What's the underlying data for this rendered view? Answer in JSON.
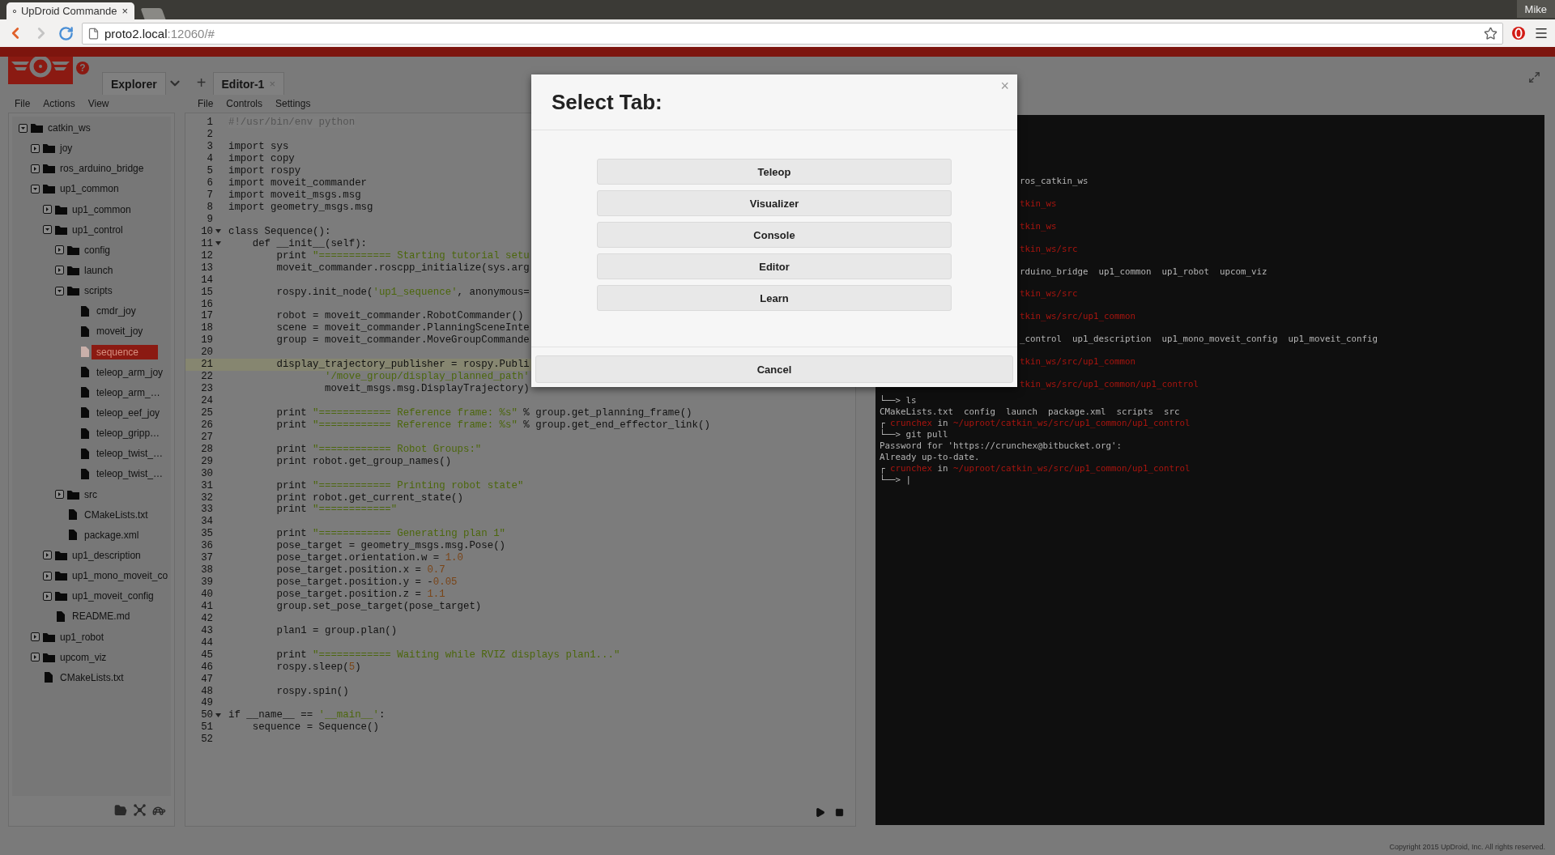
{
  "browser": {
    "tab_title": "UpDroid Commande",
    "tab_close": "×",
    "url_host": "proto2.local",
    "url_rest": ":12060/#",
    "user": "Mike"
  },
  "app": {
    "help": "?",
    "add_tab": "+"
  },
  "explorer": {
    "tab": "Explorer",
    "menu": [
      "File",
      "Actions",
      "View"
    ],
    "tree": [
      {
        "name": "catkin_ws",
        "kind": "folder",
        "expanded": true,
        "selected": false,
        "children": [
          {
            "name": "joy",
            "kind": "folder",
            "expanded": false,
            "selected": false
          },
          {
            "name": "ros_arduino_bridge",
            "kind": "folder",
            "expanded": false,
            "selected": false
          },
          {
            "name": "up1_common",
            "kind": "folder",
            "expanded": true,
            "selected": false,
            "children": [
              {
                "name": "up1_common",
                "kind": "folder",
                "expanded": false,
                "selected": false
              },
              {
                "name": "up1_control",
                "kind": "folder",
                "expanded": true,
                "selected": false,
                "children": [
                  {
                    "name": "config",
                    "kind": "folder",
                    "expanded": false,
                    "selected": false
                  },
                  {
                    "name": "launch",
                    "kind": "folder",
                    "expanded": false,
                    "selected": false
                  },
                  {
                    "name": "scripts",
                    "kind": "folder",
                    "expanded": true,
                    "selected": false,
                    "children": [
                      {
                        "name": "cmdr_joy",
                        "kind": "file",
                        "selected": false
                      },
                      {
                        "name": "moveit_joy",
                        "kind": "file",
                        "selected": false
                      },
                      {
                        "name": "sequence",
                        "kind": "file",
                        "selected": true
                      },
                      {
                        "name": "teleop_arm_joy",
                        "kind": "file",
                        "selected": false
                      },
                      {
                        "name": "teleop_arm_…",
                        "kind": "file",
                        "selected": false
                      },
                      {
                        "name": "teleop_eef_joy",
                        "kind": "file",
                        "selected": false
                      },
                      {
                        "name": "teleop_gripp…",
                        "kind": "file",
                        "selected": false
                      },
                      {
                        "name": "teleop_twist_…",
                        "kind": "file",
                        "selected": false
                      },
                      {
                        "name": "teleop_twist_…",
                        "kind": "file",
                        "selected": false
                      }
                    ]
                  },
                  {
                    "name": "src",
                    "kind": "folder",
                    "expanded": false,
                    "selected": false
                  },
                  {
                    "name": "CMakeLists.txt",
                    "kind": "file",
                    "selected": false
                  },
                  {
                    "name": "package.xml",
                    "kind": "file",
                    "selected": false
                  }
                ]
              },
              {
                "name": "up1_description",
                "kind": "folder",
                "expanded": false,
                "selected": false
              },
              {
                "name": "up1_mono_moveit_co",
                "kind": "folder",
                "expanded": false,
                "selected": false
              },
              {
                "name": "up1_moveit_config",
                "kind": "folder",
                "expanded": false,
                "selected": false
              },
              {
                "name": "README.md",
                "kind": "file",
                "selected": false
              }
            ]
          },
          {
            "name": "up1_robot",
            "kind": "folder",
            "expanded": false,
            "selected": false
          },
          {
            "name": "upcom_viz",
            "kind": "folder",
            "expanded": false,
            "selected": false
          },
          {
            "name": "CMakeLists.txt",
            "kind": "file",
            "selected": false
          }
        ]
      }
    ]
  },
  "editor": {
    "tab": "Editor-1",
    "tab_close": "×",
    "menu": [
      "File",
      "Controls",
      "Settings"
    ],
    "lines": [
      {
        "n": "1",
        "fold": false,
        "current": false,
        "code": [
          {
            "t": "#!/usr/bin/env python",
            "kind": "comment"
          }
        ]
      },
      {
        "n": "2",
        "fold": false,
        "current": false
      },
      {
        "n": "3",
        "fold": false,
        "current": false,
        "code": [
          {
            "t": "import sys",
            "kind": "plain"
          }
        ]
      },
      {
        "n": "4",
        "fold": false,
        "current": false,
        "code": [
          {
            "t": "import copy",
            "kind": "plain"
          }
        ]
      },
      {
        "n": "5",
        "fold": false,
        "current": false,
        "code": [
          {
            "t": "import rospy",
            "kind": "plain"
          }
        ]
      },
      {
        "n": "6",
        "fold": false,
        "current": false,
        "code": [
          {
            "t": "import moveit_commander",
            "kind": "plain"
          }
        ]
      },
      {
        "n": "7",
        "fold": false,
        "current": false,
        "code": [
          {
            "t": "import moveit_msgs.msg",
            "kind": "plain"
          }
        ]
      },
      {
        "n": "8",
        "fold": false,
        "current": false,
        "code": [
          {
            "t": "import geometry_msgs.msg",
            "kind": "plain"
          }
        ]
      },
      {
        "n": "9",
        "fold": false,
        "current": false
      },
      {
        "n": "10",
        "fold": true,
        "current": false,
        "code": [
          {
            "t": "class Sequence():",
            "kind": "plain"
          }
        ]
      },
      {
        "n": "11",
        "fold": true,
        "current": false,
        "code": [
          {
            "t": "    def __init__(self):",
            "kind": "plain"
          }
        ]
      },
      {
        "n": "12",
        "fold": false,
        "current": false,
        "code": [
          {
            "t": "        print ",
            "kind": "plain"
          },
          {
            "t": "\"============ Starting tutorial setu",
            "kind": "string"
          }
        ]
      },
      {
        "n": "13",
        "fold": false,
        "current": false,
        "code": [
          {
            "t": "        moveit_commander.roscpp_initialize(sys.arg",
            "kind": "plain"
          }
        ]
      },
      {
        "n": "14",
        "fold": false,
        "current": false
      },
      {
        "n": "15",
        "fold": false,
        "current": false,
        "code": [
          {
            "t": "        rospy.init_node(",
            "kind": "plain"
          },
          {
            "t": "'up1_sequence'",
            "kind": "string"
          },
          {
            "t": ", anonymous=",
            "kind": "plain"
          }
        ]
      },
      {
        "n": "16",
        "fold": false,
        "current": false
      },
      {
        "n": "17",
        "fold": false,
        "current": false,
        "code": [
          {
            "t": "        robot = moveit_commander.RobotCommander()",
            "kind": "plain"
          }
        ]
      },
      {
        "n": "18",
        "fold": false,
        "current": false,
        "code": [
          {
            "t": "        scene = moveit_commander.PlanningSceneInte",
            "kind": "plain"
          }
        ]
      },
      {
        "n": "19",
        "fold": false,
        "current": false,
        "code": [
          {
            "t": "        group = moveit_commander.MoveGroupCommande",
            "kind": "plain"
          }
        ]
      },
      {
        "n": "20",
        "fold": false,
        "current": false
      },
      {
        "n": "21",
        "fold": false,
        "current": true,
        "code": [
          {
            "t": "        display_trajectory_publisher = rospy.Publi",
            "kind": "plain"
          }
        ]
      },
      {
        "n": "22",
        "fold": false,
        "current": false,
        "code": [
          {
            "t": "                '/move_group/display_planned_path'",
            "kind": "string"
          }
        ]
      },
      {
        "n": "23",
        "fold": false,
        "current": false,
        "code": [
          {
            "t": "                moveit_msgs.msg.DisplayTrajectory)",
            "kind": "plain"
          }
        ]
      },
      {
        "n": "24",
        "fold": false,
        "current": false
      },
      {
        "n": "25",
        "fold": false,
        "current": false,
        "code": [
          {
            "t": "        print ",
            "kind": "plain"
          },
          {
            "t": "\"============ Reference frame: %s\"",
            "kind": "string"
          },
          {
            "t": " % group.get_planning_frame()",
            "kind": "plain"
          }
        ]
      },
      {
        "n": "26",
        "fold": false,
        "current": false,
        "code": [
          {
            "t": "        print ",
            "kind": "plain"
          },
          {
            "t": "\"============ Reference frame: %s\"",
            "kind": "string"
          },
          {
            "t": " % group.get_end_effector_link()",
            "kind": "plain"
          }
        ]
      },
      {
        "n": "27",
        "fold": false,
        "current": false
      },
      {
        "n": "28",
        "fold": false,
        "current": false,
        "code": [
          {
            "t": "        print ",
            "kind": "plain"
          },
          {
            "t": "\"============ Robot Groups:\"",
            "kind": "string"
          }
        ]
      },
      {
        "n": "29",
        "fold": false,
        "current": false,
        "code": [
          {
            "t": "        print robot.get_group_names()",
            "kind": "plain"
          }
        ]
      },
      {
        "n": "30",
        "fold": false,
        "current": false
      },
      {
        "n": "31",
        "fold": false,
        "current": false,
        "code": [
          {
            "t": "        print ",
            "kind": "plain"
          },
          {
            "t": "\"============ Printing robot state\"",
            "kind": "string"
          }
        ]
      },
      {
        "n": "32",
        "fold": false,
        "current": false,
        "code": [
          {
            "t": "        print robot.get_current_state()",
            "kind": "plain"
          }
        ]
      },
      {
        "n": "33",
        "fold": false,
        "current": false,
        "code": [
          {
            "t": "        print ",
            "kind": "plain"
          },
          {
            "t": "\"============\"",
            "kind": "string"
          }
        ]
      },
      {
        "n": "34",
        "fold": false,
        "current": false
      },
      {
        "n": "35",
        "fold": false,
        "current": false,
        "code": [
          {
            "t": "        print ",
            "kind": "plain"
          },
          {
            "t": "\"============ Generating plan 1\"",
            "kind": "string"
          }
        ]
      },
      {
        "n": "36",
        "fold": false,
        "current": false,
        "code": [
          {
            "t": "        pose_target = geometry_msgs.msg.Pose()",
            "kind": "plain"
          }
        ]
      },
      {
        "n": "37",
        "fold": false,
        "current": false,
        "code": [
          {
            "t": "        pose_target.orientation.w = ",
            "kind": "plain"
          },
          {
            "t": "1.0",
            "kind": "number"
          }
        ]
      },
      {
        "n": "38",
        "fold": false,
        "current": false,
        "code": [
          {
            "t": "        pose_target.position.x = ",
            "kind": "plain"
          },
          {
            "t": "0.7",
            "kind": "number"
          }
        ]
      },
      {
        "n": "39",
        "fold": false,
        "current": false,
        "code": [
          {
            "t": "        pose_target.position.y = -",
            "kind": "plain"
          },
          {
            "t": "0.05",
            "kind": "number"
          }
        ]
      },
      {
        "n": "40",
        "fold": false,
        "current": false,
        "code": [
          {
            "t": "        pose_target.position.z = ",
            "kind": "plain"
          },
          {
            "t": "1.1",
            "kind": "number"
          }
        ]
      },
      {
        "n": "41",
        "fold": false,
        "current": false,
        "code": [
          {
            "t": "        group.set_pose_target(pose_target)",
            "kind": "plain"
          }
        ]
      },
      {
        "n": "42",
        "fold": false,
        "current": false
      },
      {
        "n": "43",
        "fold": false,
        "current": false,
        "code": [
          {
            "t": "        plan1 = group.plan()",
            "kind": "plain"
          }
        ]
      },
      {
        "n": "44",
        "fold": false,
        "current": false
      },
      {
        "n": "45",
        "fold": false,
        "current": false,
        "code": [
          {
            "t": "        print ",
            "kind": "plain"
          },
          {
            "t": "\"============ Waiting while RVIZ displays plan1...\"",
            "kind": "string"
          }
        ]
      },
      {
        "n": "46",
        "fold": false,
        "current": false,
        "code": [
          {
            "t": "        rospy.sleep(",
            "kind": "plain"
          },
          {
            "t": "5",
            "kind": "number"
          },
          {
            "t": ")",
            "kind": "plain"
          }
        ]
      },
      {
        "n": "47",
        "fold": false,
        "current": false
      },
      {
        "n": "48",
        "fold": false,
        "current": false,
        "code": [
          {
            "t": "        rospy.spin()",
            "kind": "plain"
          }
        ]
      },
      {
        "n": "49",
        "fold": false,
        "current": false
      },
      {
        "n": "50",
        "fold": true,
        "current": false,
        "code": [
          {
            "t": "if __name__ == ",
            "kind": "plain"
          },
          {
            "t": "'__main__'",
            "kind": "string"
          },
          {
            "t": ":",
            "kind": "plain"
          }
        ]
      },
      {
        "n": "51",
        "fold": false,
        "current": false,
        "code": [
          {
            "t": "    sequence = Sequence()",
            "kind": "plain"
          }
        ]
      },
      {
        "n": "52",
        "fold": false,
        "current": false
      }
    ]
  },
  "console": {
    "lines": [
      {
        "kind": "partial",
        "parts": [
          {
            "t": "ros_catkin_ws",
            "kind": "plain"
          }
        ]
      },
      {
        "kind": "partial",
        "parts": [
          {
            "t": "tkin_ws",
            "kind": "red"
          }
        ]
      },
      {
        "kind": "partial",
        "parts": [
          {
            "t": "tkin_ws",
            "kind": "red"
          }
        ]
      },
      {
        "kind": "partial",
        "parts": [
          {
            "t": "tkin_ws/src",
            "kind": "red"
          }
        ]
      },
      {
        "kind": "partial",
        "parts": [
          {
            "t": "rduino_bridge  up1_common  up1_robot  upcom_viz",
            "kind": "plain"
          }
        ]
      },
      {
        "kind": "partial",
        "parts": [
          {
            "t": "tkin_ws/src",
            "kind": "red"
          }
        ]
      },
      {
        "kind": "partial",
        "parts": [
          {
            "t": "tkin_ws/src/up1_common",
            "kind": "red"
          }
        ]
      },
      {
        "kind": "partial",
        "parts": [
          {
            "t": "_control  up1_description  up1_mono_moveit_config  up1_moveit_config",
            "kind": "plain"
          }
        ]
      },
      {
        "kind": "partial",
        "parts": [
          {
            "t": "tkin_ws/src/up1_common",
            "kind": "red"
          }
        ]
      },
      {
        "kind": "partial",
        "parts": [
          {
            "t": "tkin_ws/src/up1_common/up1_control",
            "kind": "red"
          }
        ]
      },
      {
        "kind": "full",
        "parts": [
          {
            "t": "└──> ls",
            "kind": "plain"
          }
        ]
      },
      {
        "kind": "full",
        "parts": [
          {
            "t": "CMakeLists.txt  config  launch  package.xml  scripts  src",
            "kind": "plain"
          }
        ]
      },
      {
        "kind": "full",
        "parts": [
          {
            "t": "┌ ",
            "kind": "plain"
          },
          {
            "t": "crunchex",
            "kind": "red"
          },
          {
            "t": " in ",
            "kind": "plain"
          },
          {
            "t": "~/uproot/catkin_ws/src/up1_common/up1_control",
            "kind": "red"
          }
        ]
      },
      {
        "kind": "full",
        "parts": [
          {
            "t": "└──> git pull",
            "kind": "plain"
          }
        ]
      },
      {
        "kind": "full",
        "parts": [
          {
            "t": "Password for 'https://crunchex@bitbucket.org':",
            "kind": "plain"
          }
        ]
      },
      {
        "kind": "full",
        "parts": [
          {
            "t": "Already up-to-date.",
            "kind": "plain"
          }
        ]
      },
      {
        "kind": "full",
        "parts": [
          {
            "t": "┌ ",
            "kind": "plain"
          },
          {
            "t": "crunchex",
            "kind": "red"
          },
          {
            "t": " in ",
            "kind": "plain"
          },
          {
            "t": "~/uproot/catkin_ws/src/up1_common/up1_control",
            "kind": "red"
          }
        ]
      },
      {
        "kind": "full",
        "parts": [
          {
            "t": "└──> |",
            "kind": "plain"
          }
        ]
      }
    ]
  },
  "dialog": {
    "title": "Select Tab:",
    "close": "×",
    "options": [
      "Teleop",
      "Visualizer",
      "Console",
      "Editor",
      "Learn"
    ],
    "cancel": "Cancel"
  },
  "footer": {
    "copyright": "Copyright 2015 UpDroid, Inc. All rights reserved."
  }
}
